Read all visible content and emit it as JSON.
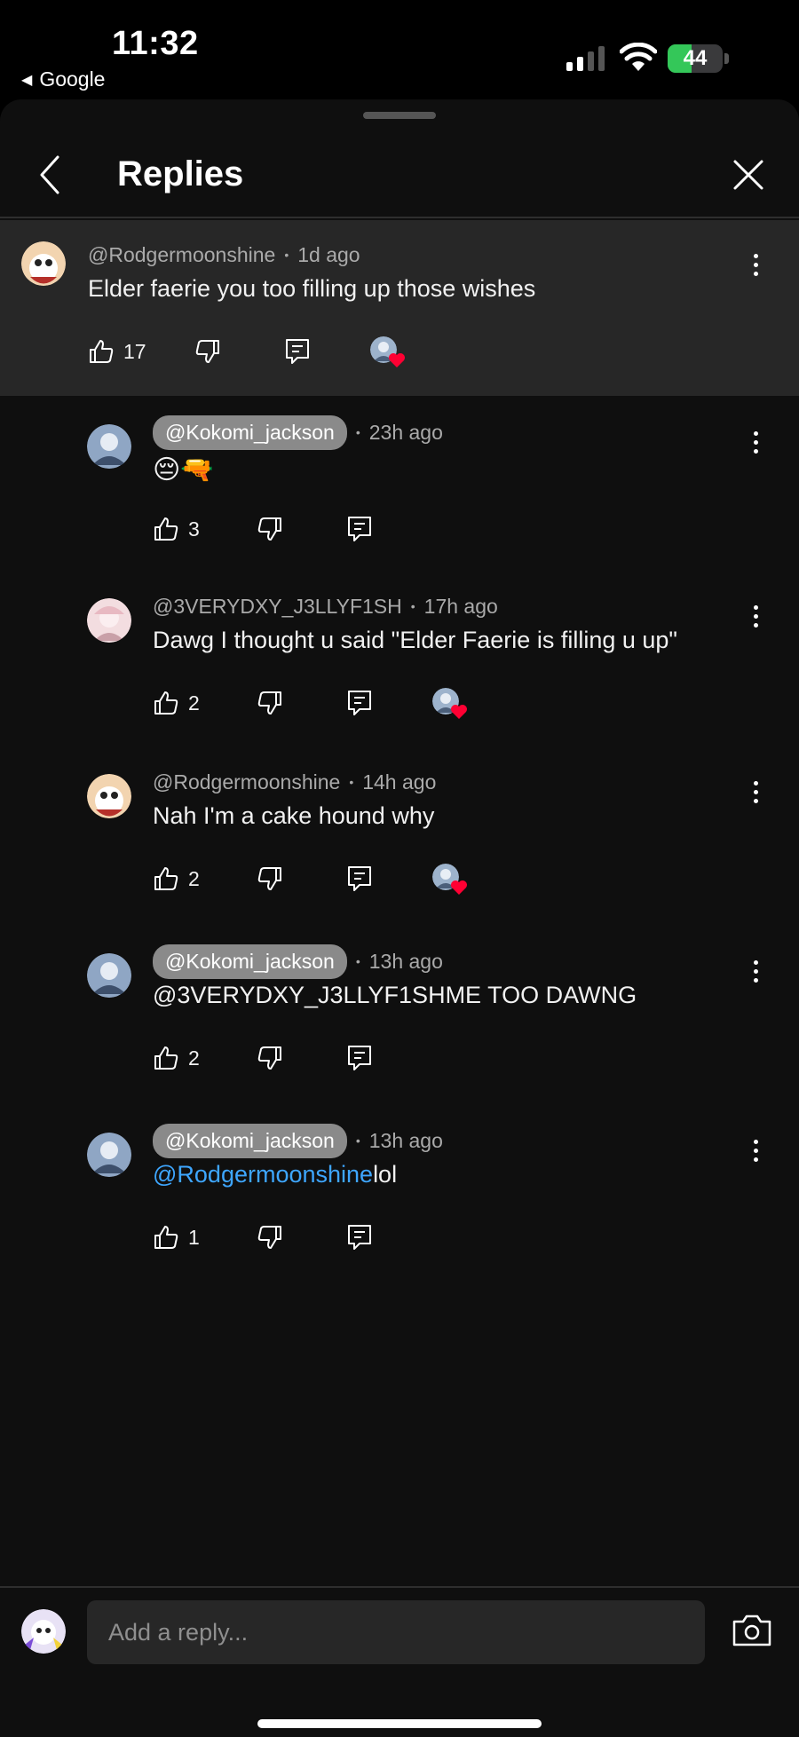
{
  "status_bar": {
    "time": "11:32",
    "back_app": "Google",
    "battery": "44",
    "battery_level": 0.44
  },
  "header": {
    "title": "Replies"
  },
  "parent": {
    "author": "@Rodgermoonshine",
    "time": "1d ago",
    "text": "Elder faerie you too filling up those wishes",
    "likes": "17",
    "creator_heart": true
  },
  "replies": [
    {
      "author": "@Kokomi_jackson",
      "highlight": true,
      "time": "23h ago",
      "text": "😔🔫",
      "likes": "3",
      "creator_heart": false
    },
    {
      "author": "@3VERYDXY_J3LLYF1SH",
      "highlight": false,
      "time": "17h ago",
      "text": "Dawg I thought u said \"Elder Faerie is filling u up\"",
      "likes": "2",
      "creator_heart": true
    },
    {
      "author": "@Rodgermoonshine",
      "highlight": false,
      "time": "14h ago",
      "text": "Nah I'm a cake hound why",
      "likes": "2",
      "creator_heart": true
    },
    {
      "author": "@Kokomi_jackson",
      "highlight": true,
      "time": "13h ago",
      "text": "@3VERYDXY_J3LLYF1SHME TOO DAWNG",
      "likes": "2",
      "creator_heart": false
    },
    {
      "author": "@Kokomi_jackson",
      "highlight": true,
      "time": "13h ago",
      "mention": "@Rodgermoonshine",
      "text": "lol",
      "likes": "1",
      "creator_heart": false
    }
  ],
  "reply_bar": {
    "placeholder": "Add a reply..."
  },
  "colors": {
    "background": "#0f0f0f",
    "parent_highlight": "#272727",
    "mention": "#3ea6ff",
    "heart": "#ff0033",
    "battery": "#34c759"
  },
  "icons": [
    "chevron-left-icon",
    "close-icon",
    "like-icon",
    "dislike-icon",
    "reply-icon",
    "more-vert-icon",
    "heart-icon",
    "camera-icon"
  ]
}
